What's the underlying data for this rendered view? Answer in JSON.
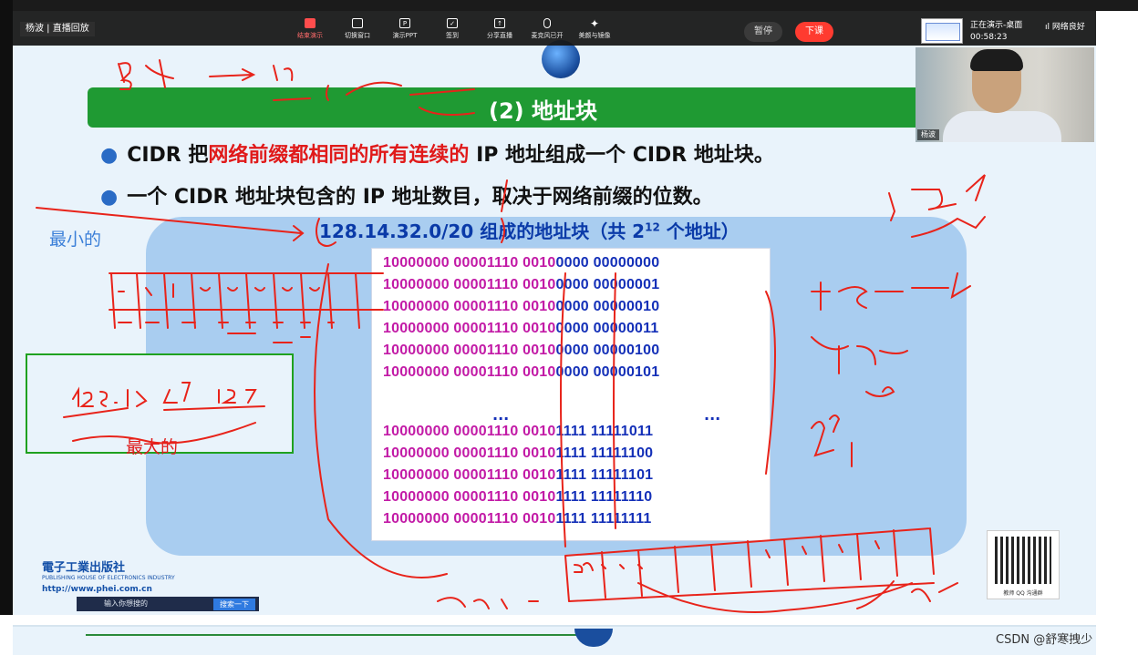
{
  "presenter_label": "杨波 | 直播回放",
  "toolbar": {
    "items": [
      {
        "label": "结束演示",
        "icon": "screen-share-icon"
      },
      {
        "label": "切换窗口",
        "icon": "window-switch-icon"
      },
      {
        "label": "演示PPT",
        "icon": "ppt-icon"
      },
      {
        "label": "签到",
        "icon": "checkin-icon"
      },
      {
        "label": "分享直播",
        "icon": "share-icon"
      },
      {
        "label": "麦克风已开",
        "icon": "microphone-icon"
      },
      {
        "label": "美颜与镜像",
        "icon": "beauty-icon"
      }
    ],
    "pause_label": "暂停",
    "end_label": "下课"
  },
  "status": {
    "line1": "正在演示-桌面",
    "line2": "00:58:23",
    "network": "网络良好"
  },
  "webcam": {
    "name": "杨波"
  },
  "slide": {
    "title": "(2) 地址块",
    "bullet1_pre": "CIDR 把",
    "bullet1_red": "网络前缀都相同的所有连续的",
    "bullet1_post": " IP 地址组成一个 CIDR 地址块。",
    "bullet2": "一个 CIDR 地址块包含的 IP 地址数目，取决于网络前缀的位数。",
    "subtitle_pre": "128.14.32.0/20 组成的地址块（共 2",
    "subtitle_exp": "12",
    "subtitle_post": " 个地址）",
    "prefix_part": "10000000 00001110 0010",
    "rows_top": [
      {
        "host_a": "0000",
        "host_b": "00000000"
      },
      {
        "host_a": "0000",
        "host_b": "00000001"
      },
      {
        "host_a": "0000",
        "host_b": "00000010"
      },
      {
        "host_a": "0000",
        "host_b": "00000011"
      },
      {
        "host_a": "0000",
        "host_b": "00000100"
      },
      {
        "host_a": "0000",
        "host_b": "00000101"
      }
    ],
    "ellipsis": "...",
    "rows_bottom": [
      {
        "host_a": "1111",
        "host_b": "11111011"
      },
      {
        "host_a": "1111",
        "host_b": "11111100"
      },
      {
        "host_a": "1111",
        "host_b": "11111101"
      },
      {
        "host_a": "1111",
        "host_b": "11111110"
      },
      {
        "host_a": "1111",
        "host_b": "11111111"
      }
    ]
  },
  "annotations": {
    "min_label": "最小的",
    "max_label": "最大的"
  },
  "footer": {
    "publisher": "電子工業出版社",
    "publisher_en": "PUBLISHING HOUSE OF ELECTRONICS INDUSTRY",
    "url": "http://www.phei.com.cn",
    "search_placeholder": "输入你想搜的",
    "search_button": "搜索一下",
    "qr_caption": "教师 QQ 沟通群"
  },
  "watermark": "CSDN @舒寒拽少"
}
